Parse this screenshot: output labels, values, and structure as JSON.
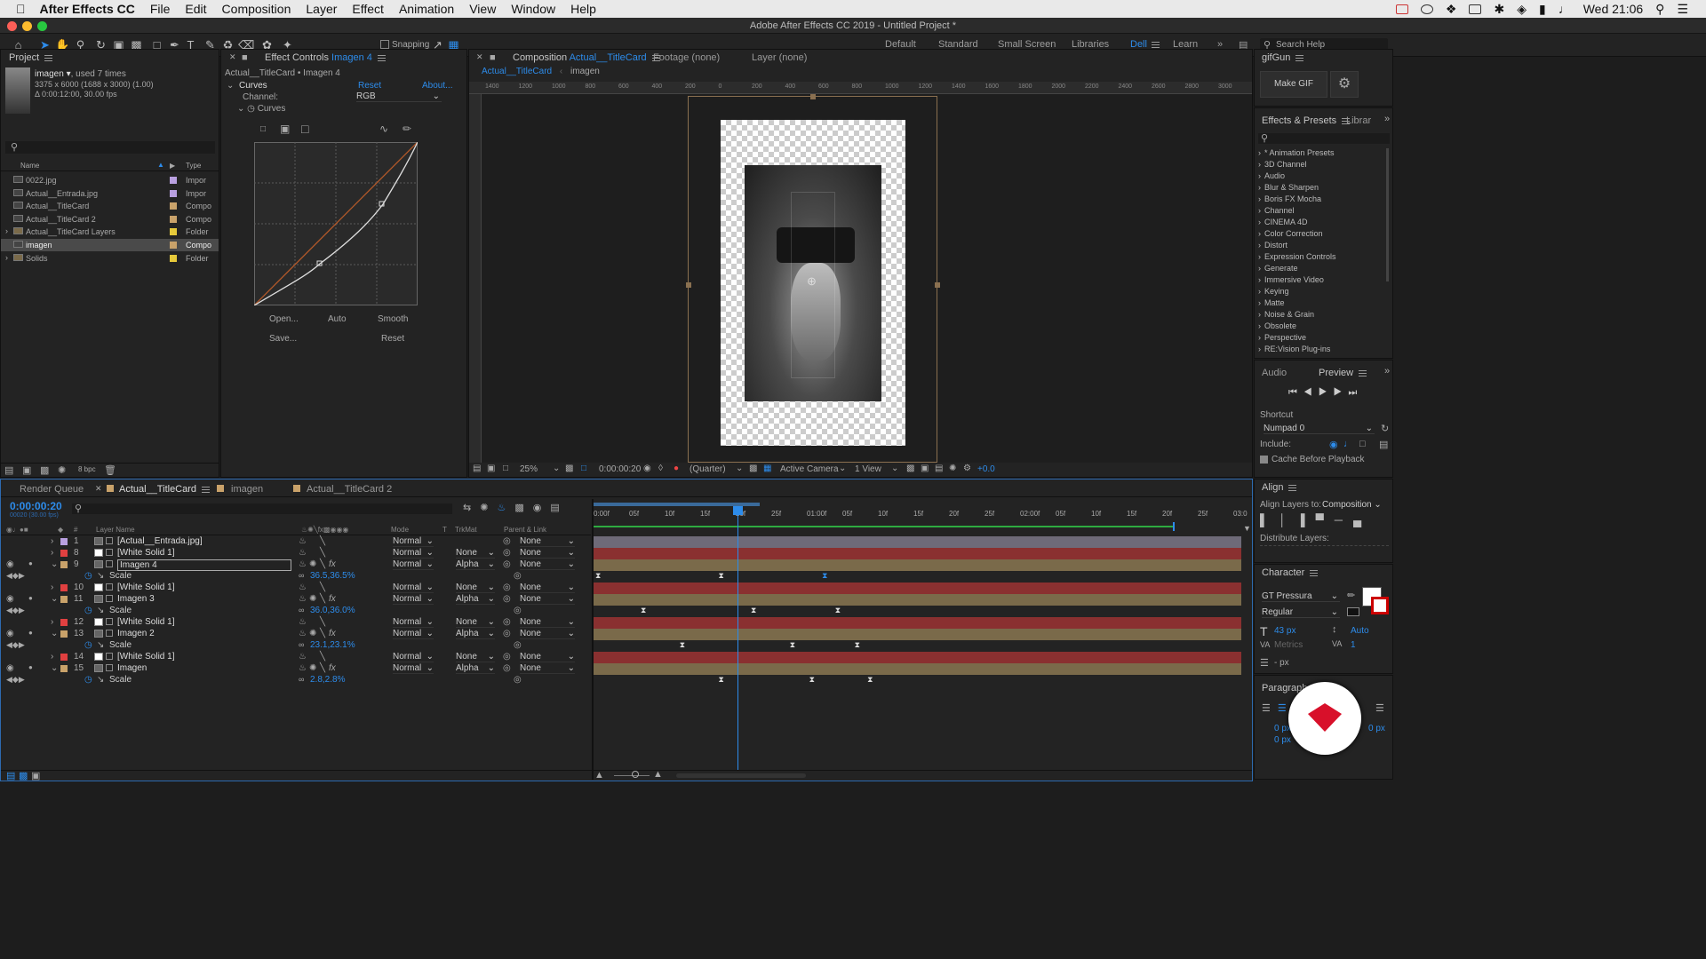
{
  "menubar": {
    "app": "After Effects CC",
    "items": [
      "File",
      "Edit",
      "Composition",
      "Layer",
      "Effect",
      "Animation",
      "View",
      "Window",
      "Help"
    ],
    "clock": "Wed 21:06"
  },
  "window_title": "Adobe After Effects CC 2019 - Untitled Project *",
  "toolbar": {
    "snapping_label": "Snapping",
    "workspaces": [
      "Default",
      "Standard",
      "Small Screen",
      "Libraries",
      "Dell",
      "Learn"
    ],
    "active_workspace": "Dell",
    "search_placeholder": "Search Help"
  },
  "project": {
    "tab": "Project",
    "selected_name": "imagen ▾",
    "used": ", used 7 times",
    "info1": "3375 x 6000 (1688 x 3000) (1.00)",
    "info2": "Δ 0:00:12:00, 30.00 fps",
    "col_name": "Name",
    "col_type": "Type",
    "items": [
      {
        "name": "0022.jpg",
        "type": "Impor",
        "color": "#b9a0e0"
      },
      {
        "name": "Actual__Entrada.jpg",
        "type": "Impor",
        "color": "#b9a0e0"
      },
      {
        "name": "Actual__TitleCard",
        "type": "Compo",
        "color": "#c9a26a"
      },
      {
        "name": "Actual__TitleCard 2",
        "type": "Compo",
        "color": "#c9a26a"
      },
      {
        "name": "Actual__TitleCard Layers",
        "type": "Folder",
        "color": "#e6c93a"
      },
      {
        "name": "imagen",
        "type": "Compo",
        "color": "#c9a26a"
      },
      {
        "name": "Solids",
        "type": "Folder",
        "color": "#e6c93a"
      }
    ],
    "bpc": "8 bpc"
  },
  "effect_controls": {
    "tab_prefix": "Effect Controls",
    "tab_layer": "Imagen 4",
    "subtitle": "Actual__TitleCard • Imagen 4",
    "effect": "Curves",
    "reset": "Reset",
    "about": "About...",
    "channel_label": "Channel:",
    "channel_value": "RGB",
    "curves_label": "Curves",
    "buttons": [
      "Open...",
      "Auto",
      "Smooth",
      "Save...",
      "Reset"
    ]
  },
  "composition": {
    "tab_prefix": "Composition",
    "tab_comp": "Actual__TitleCard",
    "footage": "Footage (none)",
    "layer": "Layer (none)",
    "crumb1": "Actual__TitleCard",
    "crumb2": "imagen",
    "ruler_labels": [
      "1400",
      "1200",
      "1000",
      "800",
      "600",
      "400",
      "200",
      "0",
      "200",
      "400",
      "600",
      "800",
      "1000",
      "1200",
      "1400",
      "1600",
      "1800",
      "2000",
      "2200",
      "2400",
      "2600",
      "2800",
      "3000"
    ],
    "zoom": "25%",
    "timecode": "0:00:00:20",
    "resolution": "(Quarter)",
    "camera": "Active Camera",
    "views": "1 View",
    "exposure": "+0.0"
  },
  "right": {
    "gifgun_tab": "gifGun",
    "make_gif": "Make GIF",
    "effects_tab": "Effects & Presets",
    "librar_tab": "Librar",
    "effects": [
      "* Animation Presets",
      "3D Channel",
      "Audio",
      "Blur & Sharpen",
      "Boris FX Mocha",
      "Channel",
      "CINEMA 4D",
      "Color Correction",
      "Distort",
      "Expression Controls",
      "Generate",
      "Immersive Video",
      "Keying",
      "Matte",
      "Noise & Grain",
      "Obsolete",
      "Perspective",
      "RE:Vision Plug-ins"
    ],
    "audio_tab": "Audio",
    "preview_tab": "Preview",
    "shortcut_label": "Shortcut",
    "shortcut_value": "Numpad 0",
    "include_label": "Include:",
    "cache_label": "Cache Before Playback",
    "align_tab": "Align",
    "align_to_label": "Align Layers to:",
    "align_to_value": "Composition",
    "distribute_label": "Distribute Layers:",
    "character_tab": "Character",
    "font": "GT Pressura",
    "style": "Regular",
    "size": "43 px",
    "leading": "Auto",
    "kerning": "Metrics",
    "tracking": "1",
    "stroke": "- px",
    "paragraph_tab": "Paragraph",
    "indent1": "0 px",
    "indent2": "0 px",
    "indent3": "0 px"
  },
  "timeline": {
    "tabs": [
      "Render Queue",
      "Actual__TitleCard",
      "imagen",
      "Actual__TitleCard 2"
    ],
    "active_tab": "Actual__TitleCard",
    "timecode": "0:00:00:20",
    "timecode_sub": "00020 (30.00 fps)",
    "col_layer_name": "Layer Name",
    "col_mode": "Mode",
    "col_t": "T",
    "col_trkmat": "TrkMat",
    "col_parent": "Parent & Link",
    "ruler": [
      "0:00f",
      "05f",
      "10f",
      "15f",
      "20f",
      "25f",
      "01:00f",
      "05f",
      "10f",
      "15f",
      "20f",
      "25f",
      "02:00f",
      "05f",
      "10f",
      "15f",
      "20f",
      "25f",
      "03:0"
    ],
    "playhead_fraction": 0.222,
    "layers": [
      {
        "num": "1",
        "name": "[Actual__Entrada.jpg]",
        "label": "#b9a0e0",
        "mode": "Normal",
        "trk": "",
        "parent": "None",
        "bar": "#6e6a78",
        "prop": false
      },
      {
        "num": "8",
        "name": "[White Solid 1]",
        "label": "#e04040",
        "mode": "Normal",
        "trk": "None",
        "parent": "None",
        "bar": "#8a3030",
        "prop": false
      },
      {
        "num": "9",
        "name": "Imagen 4",
        "label": "#c9a26a",
        "mode": "Normal",
        "trk": "Alpha",
        "parent": "None",
        "bar": "#7a6a4a",
        "prop": false,
        "selected": true
      },
      {
        "prop": true,
        "name": "Scale",
        "value": "36.5,36.5%"
      },
      {
        "num": "10",
        "name": "[White Solid 1]",
        "label": "#e04040",
        "mode": "Normal",
        "trk": "None",
        "parent": "None",
        "bar": "#8a3030",
        "prop": false
      },
      {
        "num": "11",
        "name": "Imagen 3",
        "label": "#c9a26a",
        "mode": "Normal",
        "trk": "Alpha",
        "parent": "None",
        "bar": "#7a6a4a",
        "prop": false
      },
      {
        "prop": true,
        "name": "Scale",
        "value": "36.0,36.0%"
      },
      {
        "num": "12",
        "name": "[White Solid 1]",
        "label": "#e04040",
        "mode": "Normal",
        "trk": "None",
        "parent": "None",
        "bar": "#8a3030",
        "prop": false
      },
      {
        "num": "13",
        "name": "Imagen 2",
        "label": "#c9a26a",
        "mode": "Normal",
        "trk": "Alpha",
        "parent": "None",
        "bar": "#7a6a4a",
        "prop": false
      },
      {
        "prop": true,
        "name": "Scale",
        "value": "23.1,23.1%"
      },
      {
        "num": "14",
        "name": "[White Solid 1]",
        "label": "#e04040",
        "mode": "Normal",
        "trk": "None",
        "parent": "None",
        "bar": "#8a3030",
        "prop": false
      },
      {
        "num": "15",
        "name": "Imagen",
        "label": "#c9a26a",
        "mode": "Normal",
        "trk": "Alpha",
        "parent": "None",
        "bar": "#7a6a4a",
        "prop": false
      },
      {
        "prop": true,
        "name": "Scale",
        "value": "2.8,2.8%"
      }
    ]
  },
  "colors": {
    "accent": "#2d8ceb",
    "solid": "#8a3030",
    "image": "#7a6a4a",
    "brand": "#d8102a"
  }
}
